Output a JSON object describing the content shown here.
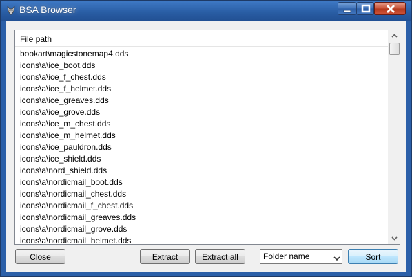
{
  "window": {
    "title": "BSA Browser"
  },
  "list": {
    "column_header": "File path",
    "rows": [
      "bookart\\magicstonemap4.dds",
      "icons\\a\\ice_boot.dds",
      "icons\\a\\ice_f_chest.dds",
      "icons\\a\\ice_f_helmet.dds",
      "icons\\a\\ice_greaves.dds",
      "icons\\a\\ice_grove.dds",
      "icons\\a\\ice_m_chest.dds",
      "icons\\a\\ice_m_helmet.dds",
      "icons\\a\\ice_pauldron.dds",
      "icons\\a\\ice_shield.dds",
      "icons\\a\\nord_shield.dds",
      "icons\\a\\nordicmail_boot.dds",
      "icons\\a\\nordicmail_chest.dds",
      "icons\\a\\nordicmail_f_chest.dds",
      "icons\\a\\nordicmail_greaves.dds",
      "icons\\a\\nordicmail_grove.dds",
      "icons\\a\\nordicmail_helmet.dds"
    ]
  },
  "buttons": {
    "close": "Close",
    "extract": "Extract",
    "extract_all": "Extract all",
    "sort": "Sort"
  },
  "sort_select": {
    "value": "Folder name"
  },
  "icons": {
    "app": "wolf-head-icon",
    "minimize": "minimize-icon",
    "maximize": "maximize-icon",
    "close": "close-icon",
    "scroll_up": "scroll-up-arrow-icon",
    "scroll_down": "scroll-down-arrow-icon",
    "dropdown": "chevron-down-icon"
  },
  "colors": {
    "titlebar": "#2b5fa8",
    "close_button": "#c9543a",
    "sort_button": "#bee6fd"
  }
}
